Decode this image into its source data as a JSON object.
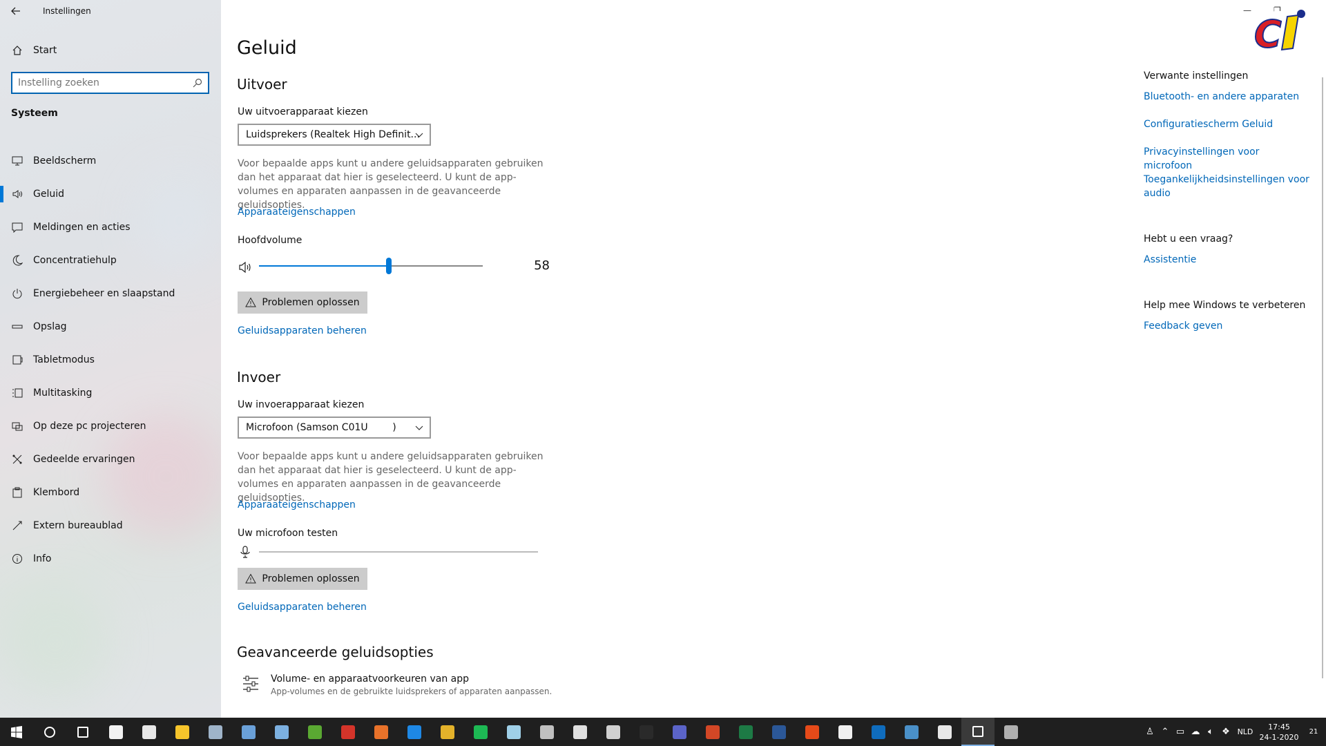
{
  "window": {
    "title": "Instellingen",
    "minimize_glyph": "—",
    "restore_glyph": "❐"
  },
  "sidebar": {
    "home_label": "Start",
    "search_placeholder": "Instelling zoeken",
    "section_title": "Systeem",
    "items": [
      {
        "label": "Beeldscherm",
        "icon": "monitor-icon",
        "active": false
      },
      {
        "label": "Geluid",
        "icon": "speaker-icon",
        "active": true
      },
      {
        "label": "Meldingen en acties",
        "icon": "notification-icon",
        "active": false
      },
      {
        "label": "Concentratiehulp",
        "icon": "moon-icon",
        "active": false
      },
      {
        "label": "Energiebeheer en slaapstand",
        "icon": "power-icon",
        "active": false
      },
      {
        "label": "Opslag",
        "icon": "storage-icon",
        "active": false
      },
      {
        "label": "Tabletmodus",
        "icon": "tablet-icon",
        "active": false
      },
      {
        "label": "Multitasking",
        "icon": "multitasking-icon",
        "active": false
      },
      {
        "label": "Op deze pc projecteren",
        "icon": "project-icon",
        "active": false
      },
      {
        "label": "Gedeelde ervaringen",
        "icon": "shared-icon",
        "active": false
      },
      {
        "label": "Klembord",
        "icon": "clipboard-icon",
        "active": false
      },
      {
        "label": "Extern bureaublad",
        "icon": "remote-icon",
        "active": false
      },
      {
        "label": "Info",
        "icon": "info-icon",
        "active": false
      }
    ]
  },
  "main": {
    "title": "Geluid",
    "output": {
      "heading": "Uitvoer",
      "device_label": "Uw uitvoerapparaat kiezen",
      "device_value": "Luidsprekers (Realtek High Definit...",
      "description": "Voor bepaalde apps kunt u andere geluidsapparaten gebruiken dan het apparaat dat hier is geselecteerd. U kunt de app-volumes en apparaten aanpassen in de geavanceerde geluidsopties.",
      "properties_link": "Apparaateigenschappen",
      "volume_label": "Hoofdvolume",
      "volume_value": "58",
      "volume_fraction": 0.58,
      "troubleshoot_label": "Problemen oplossen",
      "manage_link": "Geluidsapparaten beheren"
    },
    "input": {
      "heading": "Invoer",
      "device_label": "Uw invoerapparaat kiezen",
      "device_value": "Microfoon (Samson C01U        )",
      "description": "Voor bepaalde apps kunt u andere geluidsapparaten gebruiken dan het apparaat dat hier is geselecteerd. U kunt de app-volumes en apparaten aanpassen in de geavanceerde geluidsopties.",
      "properties_link": "Apparaateigenschappen",
      "test_label": "Uw microfoon testen",
      "troubleshoot_label": "Problemen oplossen",
      "manage_link": "Geluidsapparaten beheren"
    },
    "advanced": {
      "heading": "Geavanceerde geluidsopties",
      "item_title": "Volume- en apparaatvoorkeuren van app",
      "item_subtitle": "App-volumes en de gebruikte luidsprekers of apparaten aanpassen."
    }
  },
  "related": {
    "heading": "Verwante instellingen",
    "links": [
      "Bluetooth- en andere apparaten",
      "Configuratiescherm Geluid",
      "Privacyinstellingen voor microfoon",
      "Toegankelijkheidsinstellingen voor audio"
    ],
    "question_heading": "Hebt u een vraag?",
    "question_link": "Assistentie",
    "improve_heading": "Help mee Windows te verbeteren",
    "improve_link": "Feedback geven"
  },
  "logo": {
    "text": "Ci"
  },
  "taskbar": {
    "apps": [
      {
        "icon": "search-icon",
        "color": "#ffffff"
      },
      {
        "icon": "task-view-icon",
        "color": "#ffffff"
      },
      {
        "icon": "store-icon",
        "color": "#f2f2f2"
      },
      {
        "icon": "notepad-icon",
        "color": "#e8e8e8"
      },
      {
        "icon": "file-explorer-icon",
        "color": "#f7c52b"
      },
      {
        "icon": "photos-icon",
        "color": "#9fb4c9"
      },
      {
        "icon": "app-icon",
        "color": "#6aa0d8"
      },
      {
        "icon": "window-app-icon",
        "color": "#7cb0e0"
      },
      {
        "icon": "green-app-icon",
        "color": "#5aa832"
      },
      {
        "icon": "red-app-icon",
        "color": "#d4342a"
      },
      {
        "icon": "firefox-icon",
        "color": "#e8722a"
      },
      {
        "icon": "edge-icon",
        "color": "#1e88e5"
      },
      {
        "icon": "chrome-icon",
        "color": "#e4b22a"
      },
      {
        "icon": "spotify-icon",
        "color": "#1db954"
      },
      {
        "icon": "feather-icon",
        "color": "#9fd0e8"
      },
      {
        "icon": "globe-app-icon",
        "color": "#c0c0c0"
      },
      {
        "icon": "capture-icon",
        "color": "#e0e0e0"
      },
      {
        "icon": "font-icon",
        "color": "#d0d0d0"
      },
      {
        "icon": "terminal-icon",
        "color": "#2a2a2a"
      },
      {
        "icon": "teams-icon",
        "color": "#5b64c8"
      },
      {
        "icon": "powerpoint-icon",
        "color": "#d24726"
      },
      {
        "icon": "excel-icon",
        "color": "#1d7a45"
      },
      {
        "icon": "word-icon",
        "color": "#2b5797"
      },
      {
        "icon": "office-icon",
        "color": "#e64a19"
      },
      {
        "icon": "mail-icon",
        "color": "#f0f0f0"
      },
      {
        "icon": "outlook-icon",
        "color": "#0f6cbd"
      },
      {
        "icon": "remote-app-icon",
        "color": "#4a90c8"
      },
      {
        "icon": "calculator-icon",
        "color": "#e8e8e8"
      },
      {
        "icon": "settings-icon",
        "color": "#ffffff"
      },
      {
        "icon": "security-icon",
        "color": "#b0b0b0"
      }
    ],
    "active_index": 28,
    "language": "NLD",
    "time": "17:45",
    "date": "24-1-2020",
    "notification_count": "21"
  }
}
